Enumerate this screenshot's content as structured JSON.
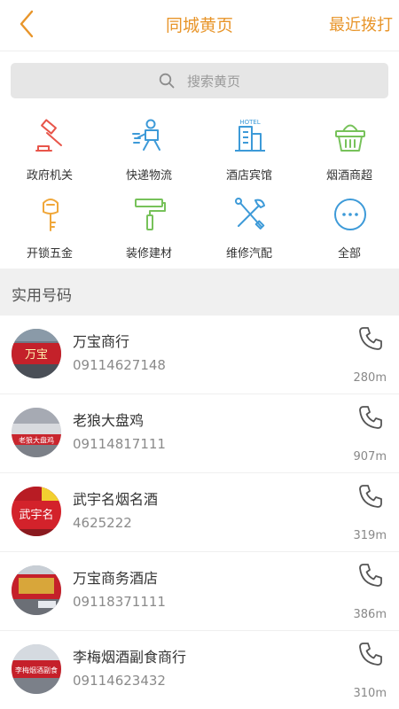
{
  "header": {
    "title": "同城黄页",
    "recent_label": "最近拨打"
  },
  "search": {
    "placeholder": "搜索黄页"
  },
  "categories": [
    {
      "label": "政府机关",
      "icon": "gavel-icon"
    },
    {
      "label": "快递物流",
      "icon": "courier-icon"
    },
    {
      "label": "酒店宾馆",
      "icon": "hotel-icon"
    },
    {
      "label": "烟酒商超",
      "icon": "basket-icon"
    },
    {
      "label": "开锁五金",
      "icon": "key-icon"
    },
    {
      "label": "装修建材",
      "icon": "paint-roller-icon"
    },
    {
      "label": "维修汽配",
      "icon": "tools-icon"
    },
    {
      "label": "全部",
      "icon": "more-icon"
    }
  ],
  "section": {
    "title": "实用号码"
  },
  "listings": [
    {
      "name": "万宝商行",
      "phone": "09114627148",
      "distance": "280m",
      "sign_text": "万宝"
    },
    {
      "name": "老狼大盘鸡",
      "phone": "09114817111",
      "distance": "907m",
      "sign_text": "老狼大盘鸡"
    },
    {
      "name": "武宇名烟名酒",
      "phone": "4625222",
      "distance": "319m",
      "sign_text": "武宇名"
    },
    {
      "name": "万宝商务酒店",
      "phone": "09118371111",
      "distance": "386m",
      "sign_text": ""
    },
    {
      "name": "李梅烟酒副食商行",
      "phone": "09114623432",
      "distance": "310m",
      "sign_text": "李梅烟酒副食"
    }
  ],
  "colors": {
    "accent": "#e8952a",
    "icon_red": "#e8554a",
    "icon_blue": "#3d9ad8",
    "icon_green": "#77c25a",
    "icon_orange": "#f0a73a"
  }
}
